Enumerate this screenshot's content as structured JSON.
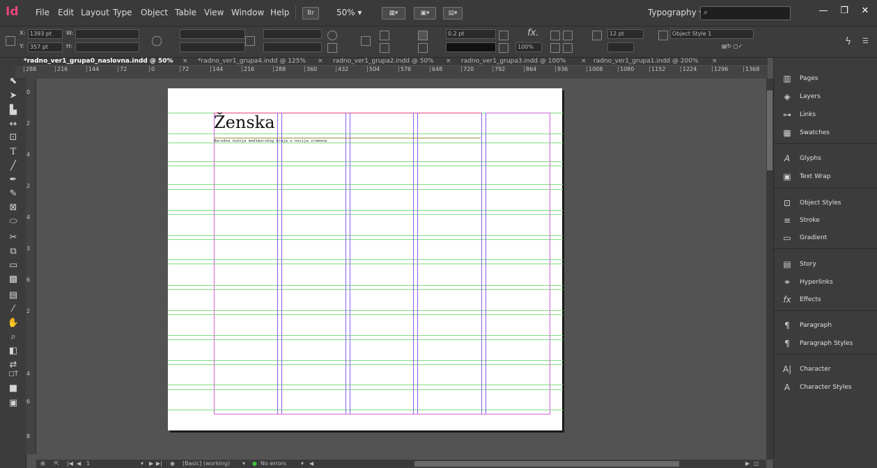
{
  "app": {
    "logo": "Id"
  },
  "menu": [
    "File",
    "Edit",
    "Layout",
    "Type",
    "Object",
    "Table",
    "View",
    "Window",
    "Help"
  ],
  "menubar": {
    "bridge": "Br",
    "zoom": "50% ▾",
    "workspace": "Typography ▾",
    "search_placeholder": ""
  },
  "window_controls": {
    "minimize": "—",
    "restore": "❐",
    "close": "✕"
  },
  "control": {
    "x_label": "X:",
    "x_value": "1393 pt",
    "y_label": "Y:",
    "y_value": "357 pt",
    "w_label": "W:",
    "h_label": "H:",
    "stroke_weight": "0.2 pt",
    "opacity": "100%",
    "font_size": "12 pt",
    "object_style": "Object Style 1"
  },
  "tabs": [
    "*radno_ver1_grupa0_naslovna.indd @ 50%",
    "*radno_ver1_grupa4.indd @ 125%",
    "radno_ver1_grupa2.indd @ 50%",
    "radno_ver1_grupa3.indd @ 100%",
    "radno_ver1_grupa1.indd @ 200%"
  ],
  "ruler": {
    "h": [
      "288",
      "216",
      "144",
      "72",
      "0",
      "72",
      "144",
      "216",
      "288",
      "360",
      "432",
      "504",
      "576",
      "648",
      "720",
      "792",
      "864",
      "936",
      "1008",
      "1080",
      "1152",
      "1224",
      "1296",
      "1368"
    ],
    "v": [
      "0",
      "2",
      "4",
      "2",
      "4",
      "3",
      "6",
      "2",
      "4",
      "6",
      "8"
    ]
  },
  "document": {
    "title": "Ženska",
    "subtitle": "Narodna nošnja međimurskog kraja u novija vremena"
  },
  "status": {
    "page": "1",
    "style": "[Basic] (working)",
    "errors": "No errors"
  },
  "panels": [
    {
      "label": "Pages",
      "icon": "pages-icon"
    },
    {
      "label": "Layers",
      "icon": "layers-icon"
    },
    {
      "label": "Links",
      "icon": "links-icon"
    },
    {
      "label": "Swatches",
      "icon": "swatches-icon"
    },
    {
      "label": "Glyphs",
      "icon": "glyphs-icon"
    },
    {
      "label": "Text Wrap",
      "icon": "text-wrap-icon"
    },
    {
      "label": "Object Styles",
      "icon": "object-styles-icon"
    },
    {
      "label": "Stroke",
      "icon": "stroke-icon"
    },
    {
      "label": "Gradient",
      "icon": "gradient-icon"
    },
    {
      "label": "Story",
      "icon": "story-icon"
    },
    {
      "label": "Hyperlinks",
      "icon": "hyperlinks-icon"
    },
    {
      "label": "Effects",
      "icon": "effects-icon"
    },
    {
      "label": "Paragraph",
      "icon": "paragraph-icon"
    },
    {
      "label": "Paragraph Styles",
      "icon": "paragraph-styles-icon"
    },
    {
      "label": "Character",
      "icon": "character-icon"
    },
    {
      "label": "Character Styles",
      "icon": "character-styles-icon"
    }
  ],
  "colors": {
    "brand": "#e8457a",
    "guide_green": "#7fdc7f",
    "margin_magenta": "#d060d8",
    "column_purple": "#8a5cf0"
  }
}
